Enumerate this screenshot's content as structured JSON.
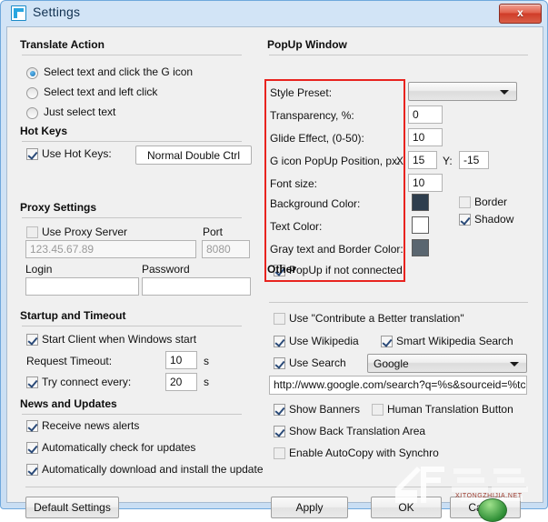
{
  "window": {
    "title": "Settings",
    "app_icon": "settings-app-icon",
    "close_label": "x"
  },
  "left": {
    "translate_action": {
      "title": "Translate Action",
      "options": [
        {
          "label": "Select text and click the G icon",
          "selected": true
        },
        {
          "label": "Select text and left click",
          "selected": false
        },
        {
          "label": "Just select text",
          "selected": false
        }
      ]
    },
    "hot_keys": {
      "title": "Hot Keys",
      "use_hot_keys_label": "Use Hot Keys:",
      "use_hot_keys_checked": true,
      "hotkey_button_label": "Normal Double Ctrl"
    },
    "proxy": {
      "title": "Proxy Settings",
      "use_proxy_label": "Use Proxy Server",
      "use_proxy_checked": false,
      "port_label": "Port",
      "server_value": "123.45.67.89",
      "port_value": "8080",
      "login_label": "Login",
      "password_label": "Password",
      "login_value": "",
      "password_value": ""
    },
    "startup": {
      "title": "Startup and Timeout",
      "start_client_label": "Start Client when Windows start",
      "start_client_checked": true,
      "request_timeout_label": "Request Timeout:",
      "request_timeout_value": "10",
      "request_timeout_unit": "s",
      "try_connect_label": "Try connect every:",
      "try_connect_checked": true,
      "try_connect_value": "20",
      "try_connect_unit": "s"
    },
    "news": {
      "title": "News and Updates",
      "items": [
        {
          "label": "Receive news alerts",
          "checked": true
        },
        {
          "label": "Automatically check for updates",
          "checked": true
        },
        {
          "label": "Automatically download and install the update",
          "checked": true
        }
      ]
    }
  },
  "right": {
    "popup": {
      "title": "PopUp Window",
      "style_preset_label": "Style Preset:",
      "style_preset_value": "",
      "transparency_label": "Transparency, %:",
      "transparency_value": "0",
      "glide_label": "Glide Effect, (0-50):",
      "glide_value": "10",
      "gicon_label": "G icon PopUp Position, px:",
      "gicon_x_label": "X",
      "gicon_x_value": "15",
      "gicon_y_label": "Y:",
      "gicon_y_value": "-15",
      "font_size_label": "Font size:",
      "font_size_value": "10",
      "background_color_label": "Background Color:",
      "background_color_value": "#2e3e4e",
      "text_color_label": "Text Color:",
      "text_color_value": "#ffffff",
      "gray_color_label": "Gray text and Border Color:",
      "gray_color_value": "#5a6670",
      "border_label": "Border",
      "border_checked": false,
      "shadow_label": "Shadow",
      "shadow_checked": true,
      "popup_not_connected_label": "PopUp if not connected",
      "popup_not_connected_checked": true,
      "highlight_color": "#e8231f"
    },
    "other": {
      "title": "Other",
      "contribute_label": "Use \"Contribute a Better translation\"",
      "contribute_checked": false,
      "use_wikipedia_label": "Use Wikipedia",
      "use_wikipedia_checked": true,
      "smart_wikipedia_label": "Smart Wikipedia Search",
      "smart_wikipedia_checked": true,
      "use_search_label": "Use Search",
      "use_search_checked": true,
      "search_engine_value": "Google",
      "search_url_value": "http://www.google.com/search?q=%s&sourceid=%tc&ie",
      "show_banners_label": "Show Banners",
      "show_banners_checked": true,
      "human_translation_label": "Human Translation Button",
      "human_translation_checked": false,
      "show_back_translation_label": "Show Back Translation Area",
      "show_back_translation_checked": true,
      "enable_autocopy_label": "Enable AutoCopy with Synchro",
      "enable_autocopy_checked": false
    }
  },
  "footer": {
    "default_settings_label": "Default Settings",
    "apply_label": "Apply",
    "ok_label": "OK",
    "cancel_label": "Cancel",
    "watermark_sub": "XITONGZHIJIA.NET"
  }
}
